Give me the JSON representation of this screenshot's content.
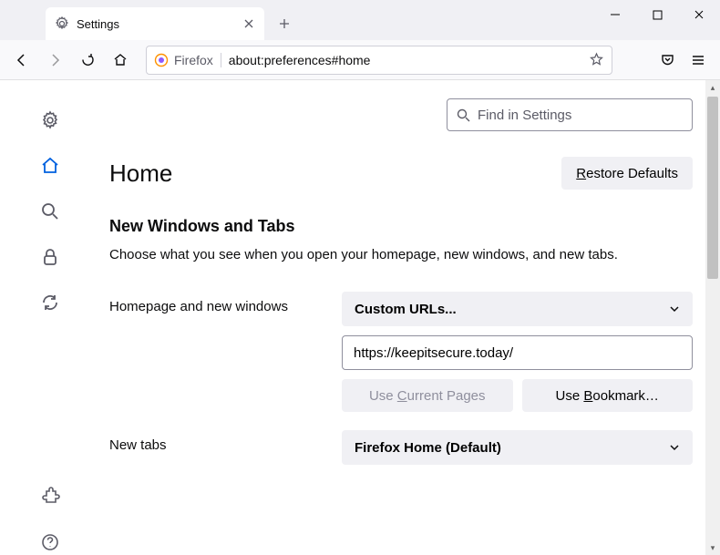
{
  "tab": {
    "title": "Settings"
  },
  "urlbar": {
    "prefix": "Firefox",
    "url": "about:preferences#home"
  },
  "search": {
    "placeholder": "Find in Settings"
  },
  "page": {
    "heading": "Home"
  },
  "buttons": {
    "restore": "Restore Defaults",
    "restore_char": "R",
    "use_current": "Use Current Pages",
    "use_bookmark": "Use Bookmark…"
  },
  "section": {
    "heading": "New Windows and Tabs",
    "desc": "Choose what you see when you open your homepage, new windows, and new tabs."
  },
  "fields": {
    "homepage_label": "Homepage and new windows",
    "homepage_dropdown": "Custom URLs...",
    "homepage_value": "https://keepitsecure.today/",
    "newtabs_label": "New tabs",
    "newtabs_dropdown": "Firefox Home (Default)"
  }
}
